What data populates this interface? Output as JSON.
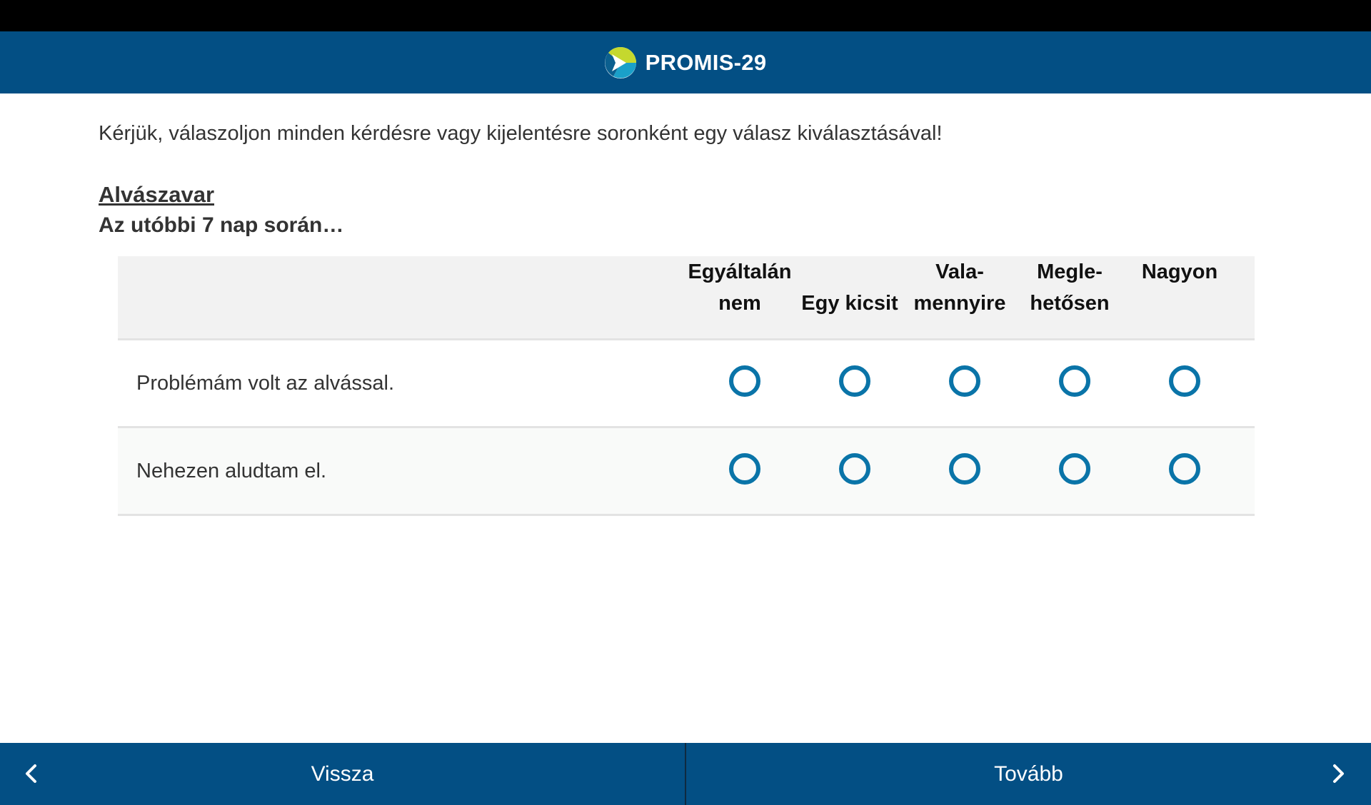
{
  "header": {
    "title": "PROMIS-29",
    "logo_icon": "promis-logo-icon",
    "bg_color": "#034f84"
  },
  "instructions": "Kérjük, válaszoljon minden kérdésre vagy kijelentésre soronként egy válasz kiválasztásával!",
  "section": {
    "title": "Alvászavar",
    "subtitle": "Az utóbbi 7 nap során…"
  },
  "table": {
    "columns": [
      {
        "line1": "Egyáltalán",
        "line2": "nem"
      },
      {
        "line1": "",
        "line2": "Egy kicsit"
      },
      {
        "line1": "Vala-",
        "line2": "mennyire"
      },
      {
        "line1": "Megle-",
        "line2": "hetősen"
      },
      {
        "line1": "Nagyon",
        "line2": ""
      }
    ],
    "rows": [
      {
        "question": "Problémám volt az alvással.",
        "selected": null
      },
      {
        "question": "Nehezen aludtam el.",
        "selected": null
      }
    ],
    "radio_color": "#0a74a8"
  },
  "footer": {
    "back_label": "Vissza",
    "next_label": "Tovább",
    "back_icon": "chevron-left-icon",
    "next_icon": "chevron-right-icon"
  }
}
